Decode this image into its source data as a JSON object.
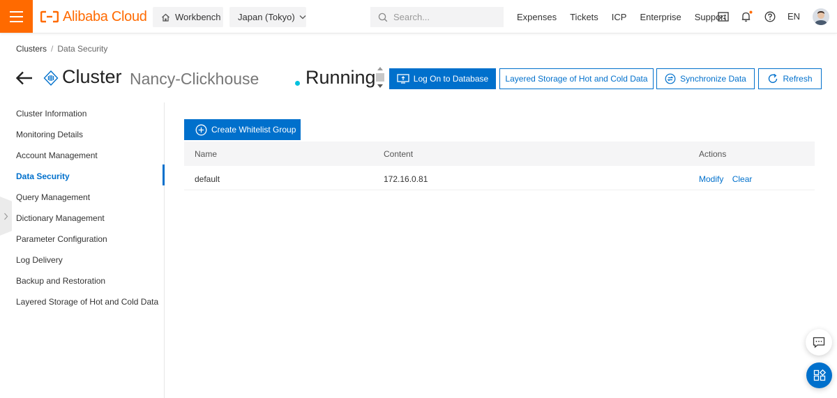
{
  "topbar": {
    "brand": "Alibaba Cloud",
    "workbench_label": "Workbench",
    "region_label": "Japan (Tokyo)",
    "search_placeholder": "Search...",
    "links": [
      "Expenses",
      "Tickets",
      "ICP",
      "Enterprise",
      "Support"
    ],
    "language": "EN",
    "icons": [
      "terminal-icon",
      "bell-icon",
      "help-icon"
    ],
    "notification_dot_color": "#ff6a00",
    "accent_color": "#ff6a00"
  },
  "breadcrumb": {
    "root": "Clusters",
    "separator": "/",
    "current": "Data Security"
  },
  "header": {
    "title": "Cluster",
    "cluster_name": "Nancy-Clickhouse",
    "status": "Running",
    "status_color": "#00c1de",
    "buttons": {
      "logon": "Log On to Database",
      "layered": "Layered Storage of Hot and Cold Data",
      "sync": "Synchronize Data",
      "refresh": "Refresh"
    }
  },
  "sidenav": {
    "items": [
      "Cluster Information",
      "Monitoring Details",
      "Account Management",
      "Data Security",
      "Query Management",
      "Dictionary Management",
      "Parameter Configuration",
      "Log Delivery",
      "Backup and Restoration",
      "Layered Storage of Hot and Cold Data"
    ],
    "active": "Data Security"
  },
  "whitelist": {
    "create_button": "Create Whitelist Group",
    "columns": {
      "name": "Name",
      "content": "Content",
      "actions": "Actions"
    },
    "rows": [
      {
        "name": "default",
        "content": "172.16.0.81",
        "actions": [
          "Modify",
          "Clear"
        ]
      }
    ]
  },
  "theme": {
    "primary": "#0070cc"
  }
}
